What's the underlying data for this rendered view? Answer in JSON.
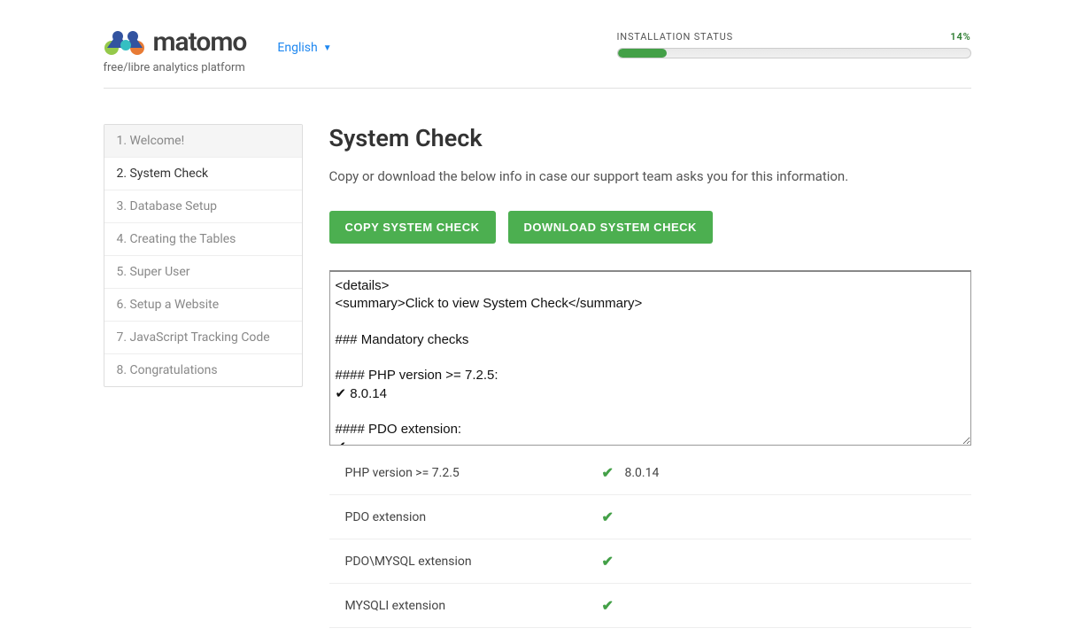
{
  "header": {
    "brand": "matomo",
    "tagline": "free/libre analytics platform",
    "language": "English",
    "status_label": "INSTALLATION STATUS",
    "status_pct": "14%",
    "progress_pct": 14
  },
  "sidebar": {
    "items": [
      {
        "label": "1. Welcome!",
        "state": "done"
      },
      {
        "label": "2. System Check",
        "state": "active"
      },
      {
        "label": "3. Database Setup",
        "state": "future"
      },
      {
        "label": "4. Creating the Tables",
        "state": "future"
      },
      {
        "label": "5. Super User",
        "state": "future"
      },
      {
        "label": "6. Setup a Website",
        "state": "future"
      },
      {
        "label": "7. JavaScript Tracking Code",
        "state": "future"
      },
      {
        "label": "8. Congratulations",
        "state": "future"
      }
    ]
  },
  "content": {
    "title": "System Check",
    "description": "Copy or download the below info in case our support team asks you for this information.",
    "copy_btn": "COPY SYSTEM CHECK",
    "download_btn": "DOWNLOAD SYSTEM CHECK",
    "textarea_value": "<details>\n<summary>Click to view System Check</summary>\n\n### Mandatory checks\n\n#### PHP version >= 7.2.5:\n✔ 8.0.14\n\n#### PDO extension:\n✔\n\n#### PDO\\MYSQL extension:"
  },
  "checks": [
    {
      "label": "PHP version >= 7.2.5",
      "ok": true,
      "value": "8.0.14"
    },
    {
      "label": "PDO extension",
      "ok": true,
      "value": ""
    },
    {
      "label": "PDO\\MYSQL extension",
      "ok": true,
      "value": ""
    },
    {
      "label": "MYSQLI extension",
      "ok": true,
      "value": ""
    }
  ]
}
